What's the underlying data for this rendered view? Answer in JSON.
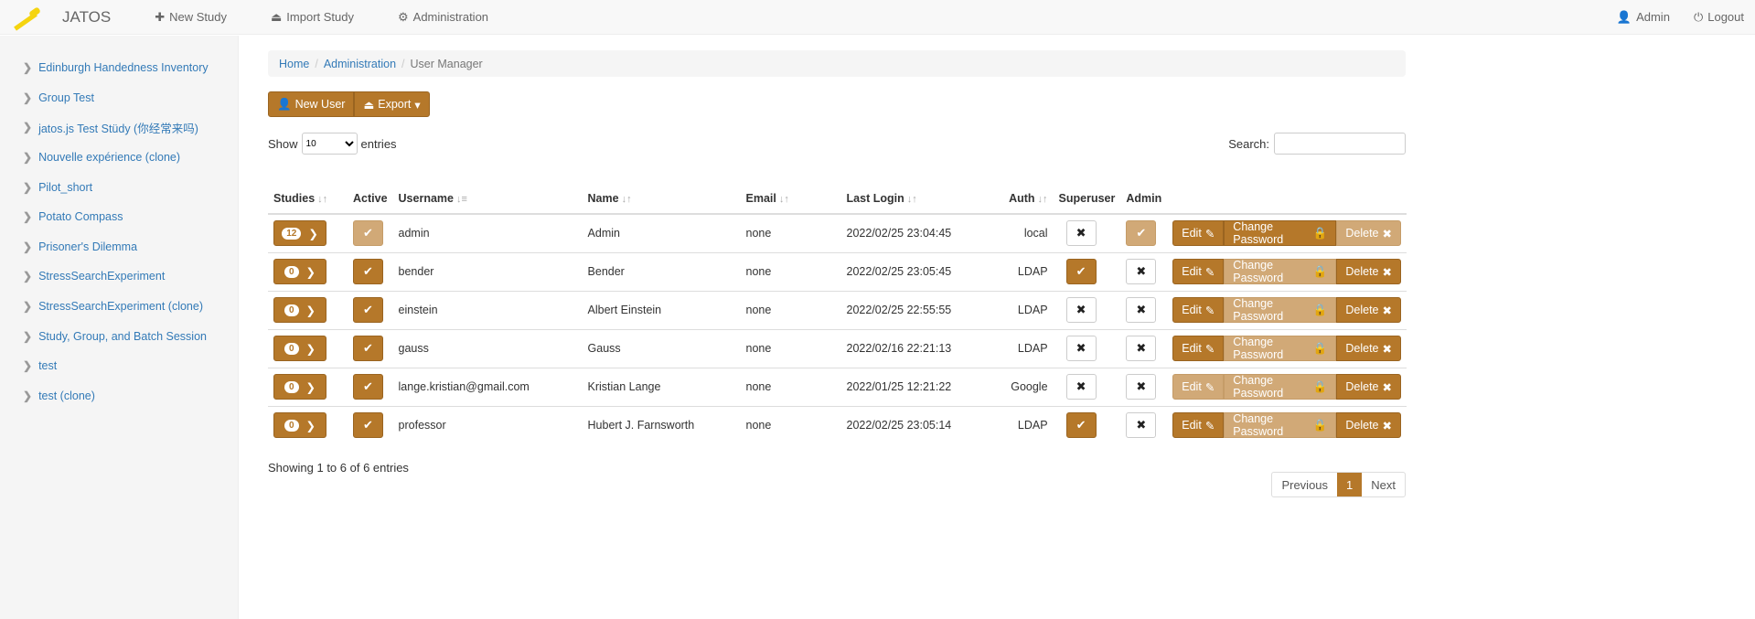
{
  "nav": {
    "brand": "JATOS",
    "new_study": "New Study",
    "import_study": "Import Study",
    "administration": "Administration",
    "user": "Admin",
    "logout": "Logout"
  },
  "sidebar": {
    "items": [
      "Edinburgh Handedness Inventory",
      "Group Test",
      "jatos.js Test Stüdy (你经常来吗)",
      "Nouvelle expérience (clone)",
      "Pilot_short",
      "Potato Compass",
      "Prisoner's Dilemma",
      "StressSearchExperiment",
      "StressSearchExperiment (clone)",
      "Study, Group, and Batch Session",
      "test",
      "test (clone)"
    ]
  },
  "breadcrumb": {
    "home": "Home",
    "admin": "Administration",
    "current": "User Manager"
  },
  "toolbar": {
    "new_user": "New User",
    "export": "Export"
  },
  "controls": {
    "show": "Show",
    "entries_value": "10",
    "entries": "entries",
    "search": "Search:"
  },
  "columns": [
    "Studies",
    "Active",
    "Username",
    "Name",
    "Email",
    "Last Login",
    "Auth",
    "Superuser",
    "Admin"
  ],
  "actions": {
    "edit": "Edit",
    "change_password": "Change Password",
    "delete": "Delete"
  },
  "colors": {
    "primary": "#b5782a",
    "disabled": "#d1a977"
  },
  "rows": [
    {
      "studies": "12",
      "active": "disabled",
      "username": "admin",
      "name": "Admin",
      "email": "none",
      "last_login": "2022/02/25 23:04:45",
      "auth": "local",
      "superuser": false,
      "admin": "disabled",
      "edit_enabled": true,
      "pw_enabled": true,
      "delete_enabled": false
    },
    {
      "studies": "0",
      "active": "on",
      "username": "bender",
      "name": "Bender",
      "email": "none",
      "last_login": "2022/02/25 23:05:45",
      "auth": "LDAP",
      "superuser": true,
      "admin": "off",
      "edit_enabled": true,
      "pw_enabled": false,
      "delete_enabled": true
    },
    {
      "studies": "0",
      "active": "on",
      "username": "einstein",
      "name": "Albert Einstein",
      "email": "none",
      "last_login": "2022/02/25 22:55:55",
      "auth": "LDAP",
      "superuser": false,
      "admin": "off",
      "edit_enabled": true,
      "pw_enabled": false,
      "delete_enabled": true
    },
    {
      "studies": "0",
      "active": "on",
      "username": "gauss",
      "name": "Gauss",
      "email": "none",
      "last_login": "2022/02/16 22:21:13",
      "auth": "LDAP",
      "superuser": false,
      "admin": "off",
      "edit_enabled": true,
      "pw_enabled": false,
      "delete_enabled": true
    },
    {
      "studies": "0",
      "active": "on",
      "username": "lange.kristian@gmail.com",
      "name": "Kristian Lange",
      "email": "none",
      "last_login": "2022/01/25 12:21:22",
      "auth": "Google",
      "superuser": false,
      "admin": "off",
      "edit_enabled": false,
      "pw_enabled": false,
      "delete_enabled": true
    },
    {
      "studies": "0",
      "active": "on",
      "username": "professor",
      "name": "Hubert J. Farnsworth",
      "email": "none",
      "last_login": "2022/02/25 23:05:14",
      "auth": "LDAP",
      "superuser": true,
      "admin": "off",
      "edit_enabled": true,
      "pw_enabled": false,
      "delete_enabled": true
    }
  ],
  "footer": {
    "info": "Showing 1 to 6 of 6 entries",
    "previous": "Previous",
    "page": "1",
    "next": "Next"
  }
}
